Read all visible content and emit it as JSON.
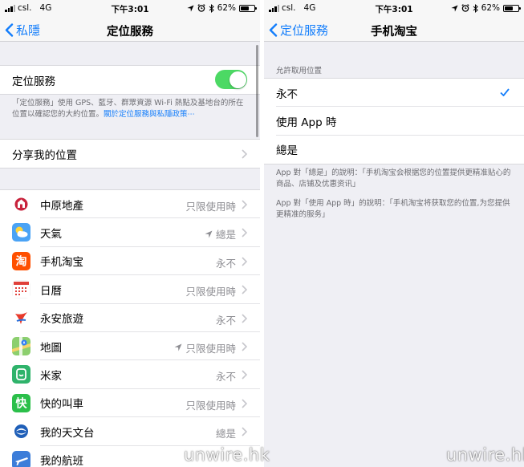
{
  "status_bar": {
    "carrier": "csl.",
    "network": "4G",
    "time": "下午3:01",
    "battery_percent": "62%",
    "battery_level": 0.62
  },
  "left": {
    "nav": {
      "back_label": "私隱",
      "title": "定位服務"
    },
    "location_services": {
      "label": "定位服務",
      "enabled": true
    },
    "description": "「定位服務」使用 GPS、藍牙、群眾資源 Wi-Fi 熱點及基地台的所在位置以確認您的大約位置。",
    "description_link": "關於定位服務與私隱政策⋯",
    "share_location": {
      "label": "分享我的位置"
    },
    "apps": [
      {
        "name": "中原地產",
        "value": "只限使用時",
        "arrow": false,
        "icon": "centaline-icon",
        "color": "#ffffff"
      },
      {
        "name": "天氣",
        "value": "總是",
        "arrow": true,
        "icon": "weather-icon",
        "color": "#4aa3f5"
      },
      {
        "name": "手机淘宝",
        "value": "永不",
        "arrow": false,
        "icon": "taobao-icon",
        "color": "#ff5000"
      },
      {
        "name": "日曆",
        "value": "只限使用時",
        "arrow": false,
        "icon": "calendar-icon",
        "color": "#ffffff"
      },
      {
        "name": "永安旅遊",
        "value": "永不",
        "arrow": false,
        "icon": "wingon-icon",
        "color": "#ffffff"
      },
      {
        "name": "地圖",
        "value": "只限使用時",
        "arrow": true,
        "icon": "maps-icon",
        "color": "#8ccf6e"
      },
      {
        "name": "米家",
        "value": "永不",
        "arrow": false,
        "icon": "mijia-icon",
        "color": "#2fb36b"
      },
      {
        "name": "快的叫車",
        "value": "只限使用時",
        "arrow": false,
        "icon": "kuaidi-icon",
        "color": "#2bbf4a"
      },
      {
        "name": "我的天文台",
        "value": "總是",
        "arrow": false,
        "icon": "myobservatory-icon",
        "color": "#ffffff"
      },
      {
        "name": "我的航班",
        "value": "",
        "arrow": false,
        "icon": "myflight-icon",
        "color": "#3c7dd9"
      }
    ]
  },
  "right": {
    "nav": {
      "back_label": "定位服務",
      "title": "手机淘宝"
    },
    "section_header": "允許取用位置",
    "options": [
      {
        "label": "永不",
        "selected": true
      },
      {
        "label": "使用 App 時",
        "selected": false
      },
      {
        "label": "總是",
        "selected": false
      }
    ],
    "note_always": "App 對「總是」的說明：「手机淘宝会根据您的位置提供更精准贴心的商品、店铺及优惠资讯」",
    "note_while_using": "App 對「使用 App 時」的說明：「手机淘宝将获取您的位置,为您提供更精准的服务」"
  },
  "watermark": "unwire.hk",
  "colors": {
    "accent": "#147efb",
    "toggle_on": "#4cd964",
    "secondary_text": "#8e8e93",
    "background": "#efeff4"
  }
}
